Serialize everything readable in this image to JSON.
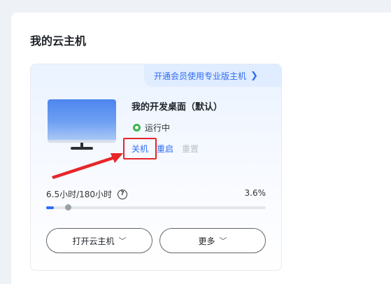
{
  "section": {
    "title": "我的云主机"
  },
  "card": {
    "promo": {
      "label": "开通会员使用专业版主机",
      "icon": "chevron-right-icon"
    },
    "vm_name": "我的开发桌面（默认）",
    "status": {
      "label": "运行中",
      "color": "#3ab54a"
    },
    "actions": {
      "shutdown": "关机",
      "restart": "重启",
      "reset": "重置"
    },
    "usage": {
      "label": "6.5小时/180小时",
      "percent_label": "3.6%",
      "fraction": 0.036
    },
    "buttons": {
      "open": "打开云主机",
      "more": "更多"
    }
  },
  "colors": {
    "accent": "#2f6df6",
    "highlight": "#e5262a",
    "disabled": "#b8bec8"
  }
}
